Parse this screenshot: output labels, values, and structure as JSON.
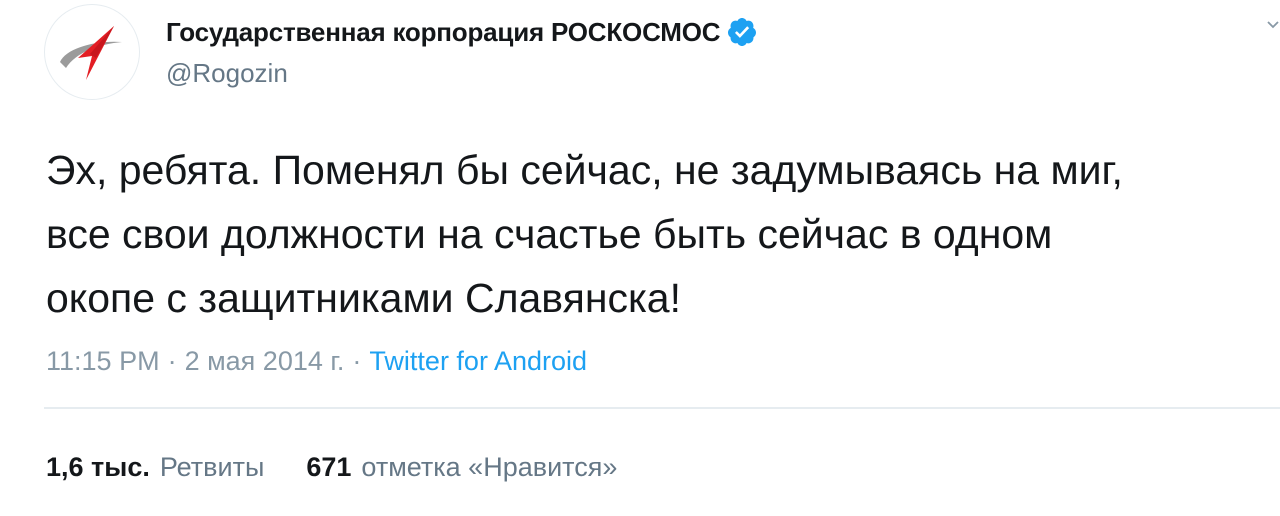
{
  "tweet": {
    "author": {
      "display_name": "Государственная корпорация РОСКОСМОС",
      "handle": "@Rogozin",
      "verified": true,
      "avatar_icon": "roscosmos-logo-icon",
      "avatar_colors": {
        "red": "#e31e24",
        "gray": "#9b9b9b"
      }
    },
    "text": "Эх, ребята.  Поменял бы сейчас, не задумываясь на миг,\nвсе свои должности на счастье быть сейчас в одном\nокопе с защитниками Славянска!",
    "time": "11:15 PM",
    "date": "2 мая 2014 г.",
    "separator": "·",
    "source": "Twitter for Android",
    "stats": {
      "retweets_count": "1,6 тыс.",
      "retweets_label": "Ретвиты",
      "likes_count": "671",
      "likes_label": "отметка «Нравится»"
    }
  },
  "colors": {
    "accent": "#1da1f2",
    "text": "#14171a",
    "secondary": "#657786",
    "muted": "#8899a6",
    "divider": "#e6ecf0"
  }
}
